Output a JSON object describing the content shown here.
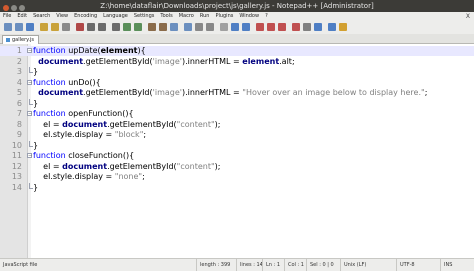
{
  "window": {
    "title": "Z:\\home\\dataflair\\Downloads\\project\\js\\gallery.js - Notepad++ [Administrator]"
  },
  "menu": {
    "items": [
      "File",
      "Edit",
      "Search",
      "View",
      "Encoding",
      "Language",
      "Settings",
      "Tools",
      "Macro",
      "Run",
      "Plugins",
      "Window",
      "?"
    ],
    "close_label": "X"
  },
  "tab": {
    "label": "gallery.js"
  },
  "editor": {
    "current_line": 1,
    "lines": [
      {
        "num": "1",
        "fold": "open",
        "tokens": [
          {
            "t": "kw",
            "s": "function "
          },
          {
            "t": "plain",
            "s": "upDate("
          },
          {
            "t": "br",
            "s": "element"
          },
          {
            "t": "plain",
            "s": "){"
          }
        ]
      },
      {
        "num": "2",
        "fold": "",
        "tokens": [
          {
            "t": "plain",
            "s": "  "
          },
          {
            "t": "obj",
            "s": "document"
          },
          {
            "t": "plain",
            "s": ".getElementById("
          },
          {
            "t": "str",
            "s": "'image'"
          },
          {
            "t": "plain",
            "s": ").innerHTML = "
          },
          {
            "t": "obj",
            "s": "element"
          },
          {
            "t": "plain",
            "s": ".alt;"
          }
        ]
      },
      {
        "num": "3",
        "fold": "end",
        "tokens": [
          {
            "t": "plain",
            "s": "}"
          }
        ]
      },
      {
        "num": "4",
        "fold": "open",
        "tokens": [
          {
            "t": "kw",
            "s": "function "
          },
          {
            "t": "plain",
            "s": "unDo(){"
          }
        ]
      },
      {
        "num": "5",
        "fold": "",
        "tokens": [
          {
            "t": "plain",
            "s": "  "
          },
          {
            "t": "obj",
            "s": "document"
          },
          {
            "t": "plain",
            "s": ".getElementById("
          },
          {
            "t": "str",
            "s": "'image'"
          },
          {
            "t": "plain",
            "s": ").innerHTML = "
          },
          {
            "t": "str",
            "s": "\"Hover over an image below to display here.\""
          },
          {
            "t": "plain",
            "s": ";"
          }
        ]
      },
      {
        "num": "6",
        "fold": "end",
        "tokens": [
          {
            "t": "plain",
            "s": "}"
          }
        ]
      },
      {
        "num": "7",
        "fold": "open",
        "tokens": [
          {
            "t": "kw",
            "s": "function "
          },
          {
            "t": "plain",
            "s": "openFunction(){"
          }
        ]
      },
      {
        "num": "8",
        "fold": "",
        "tokens": [
          {
            "t": "plain",
            "s": "    el = "
          },
          {
            "t": "obj",
            "s": "document"
          },
          {
            "t": "plain",
            "s": ".getElementById("
          },
          {
            "t": "str",
            "s": "\"content\""
          },
          {
            "t": "plain",
            "s": ");"
          }
        ]
      },
      {
        "num": "9",
        "fold": "",
        "tokens": [
          {
            "t": "plain",
            "s": "    el.style.display = "
          },
          {
            "t": "str",
            "s": "\"block\""
          },
          {
            "t": "plain",
            "s": ";"
          }
        ]
      },
      {
        "num": "10",
        "fold": "end",
        "tokens": [
          {
            "t": "plain",
            "s": "}"
          }
        ]
      },
      {
        "num": "11",
        "fold": "open",
        "tokens": [
          {
            "t": "kw",
            "s": "function "
          },
          {
            "t": "plain",
            "s": "closeFunction(){"
          }
        ]
      },
      {
        "num": "12",
        "fold": "",
        "tokens": [
          {
            "t": "plain",
            "s": "    el = "
          },
          {
            "t": "obj",
            "s": "document"
          },
          {
            "t": "plain",
            "s": ".getElementById("
          },
          {
            "t": "str",
            "s": "\"content\""
          },
          {
            "t": "plain",
            "s": ");"
          }
        ]
      },
      {
        "num": "13",
        "fold": "",
        "tokens": [
          {
            "t": "plain",
            "s": "    el.style.display = "
          },
          {
            "t": "str",
            "s": "\"none\""
          },
          {
            "t": "plain",
            "s": ";"
          }
        ]
      },
      {
        "num": "14",
        "fold": "end",
        "tokens": [
          {
            "t": "plain",
            "s": "}"
          }
        ]
      }
    ]
  },
  "status": {
    "file_type": "JavaScript file",
    "length": "length : 399",
    "lines": "lines : 14",
    "ln": "Ln : 1",
    "col": "Col : 1",
    "sel": "Sel : 0 | 0",
    "eol": "Unix (LF)",
    "encoding": "UTF-8",
    "mode": "INS"
  },
  "colors": {
    "keyword": "#0000ff",
    "string": "#808080",
    "object": "#000080",
    "current_line": "#e8e8ff"
  }
}
